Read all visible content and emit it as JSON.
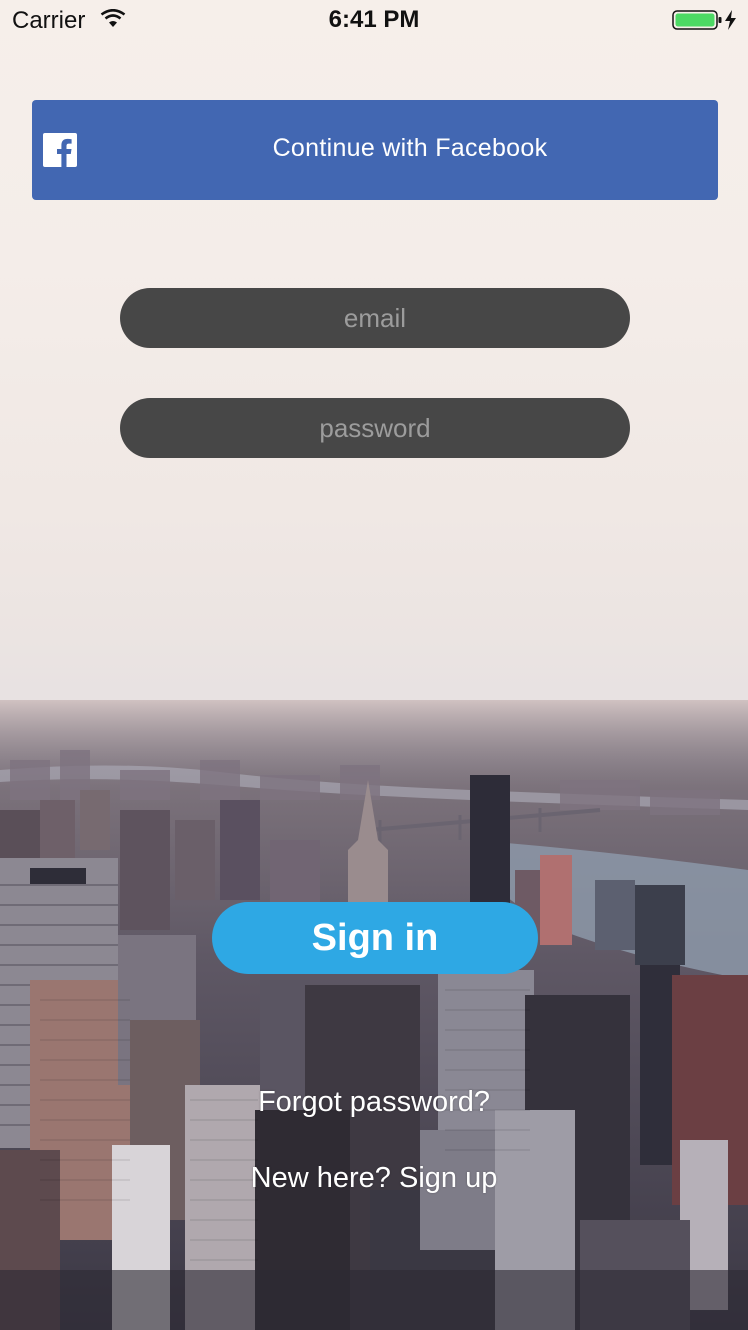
{
  "status_bar": {
    "carrier": "Carrier",
    "time": "6:41 PM",
    "icons": [
      "wifi-icon",
      "battery-charging-icon"
    ],
    "battery_color": "#4cd964"
  },
  "facebook_button": {
    "label": "Continue with Facebook",
    "icon": "facebook-icon",
    "color": "#4267b2"
  },
  "email_field": {
    "placeholder": "email",
    "value": ""
  },
  "password_field": {
    "placeholder": "password",
    "value": ""
  },
  "sign_in_button": {
    "label": "Sign in",
    "color": "#2ea8e4"
  },
  "links": {
    "forgot_password": "Forgot password?",
    "sign_up": "New here? Sign up"
  },
  "background": {
    "subject": "city-skyline-photo"
  }
}
